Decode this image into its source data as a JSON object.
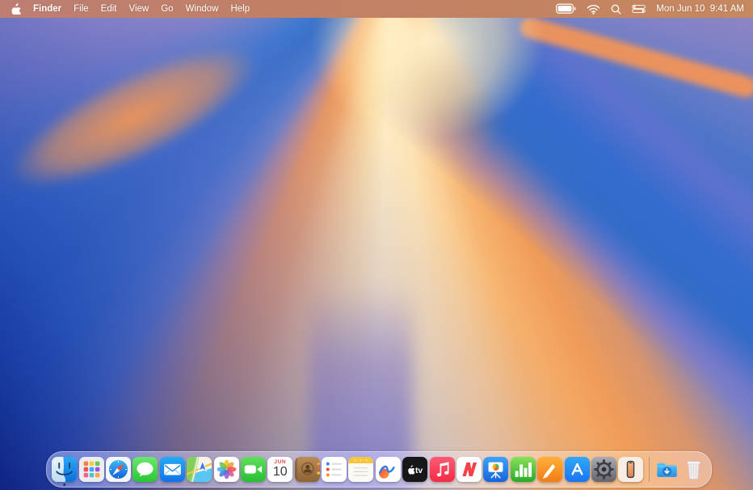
{
  "menu_bar": {
    "app_name": "Finder",
    "menus": [
      "File",
      "Edit",
      "View",
      "Go",
      "Window",
      "Help"
    ],
    "status_icons": [
      "battery-icon",
      "wifi-icon",
      "search-icon",
      "control-center-icon"
    ],
    "clock": "Mon Jun 10  9:41 AM"
  },
  "dock": {
    "apps": [
      {
        "name": "Finder",
        "icon": "finder-icon",
        "running": true
      },
      {
        "name": "Launchpad",
        "icon": "launchpad-icon"
      },
      {
        "name": "Safari",
        "icon": "safari-icon"
      },
      {
        "name": "Messages",
        "icon": "messages-icon"
      },
      {
        "name": "Mail",
        "icon": "mail-icon"
      },
      {
        "name": "Maps",
        "icon": "maps-icon"
      },
      {
        "name": "Photos",
        "icon": "photos-icon"
      },
      {
        "name": "FaceTime",
        "icon": "facetime-icon"
      },
      {
        "name": "Calendar",
        "icon": "calendar-icon",
        "month": "JUN",
        "day": "10"
      },
      {
        "name": "Contacts",
        "icon": "contacts-icon"
      },
      {
        "name": "Reminders",
        "icon": "reminders-icon"
      },
      {
        "name": "Notes",
        "icon": "notes-icon"
      },
      {
        "name": "Freeform",
        "icon": "freeform-icon"
      },
      {
        "name": "Apple TV",
        "icon": "apple-tv-icon",
        "label": "tv"
      },
      {
        "name": "Music",
        "icon": "music-icon"
      },
      {
        "name": "News",
        "icon": "news-icon"
      },
      {
        "name": "Keynote",
        "icon": "keynote-icon"
      },
      {
        "name": "Numbers",
        "icon": "numbers-icon"
      },
      {
        "name": "Pages",
        "icon": "pages-icon"
      },
      {
        "name": "App Store",
        "icon": "app-store-icon"
      },
      {
        "name": "System Settings",
        "icon": "system-settings-icon"
      },
      {
        "name": "iPhone Mirroring",
        "icon": "iphone-mirroring-icon"
      },
      {
        "name": "Downloads",
        "icon": "downloads-folder-icon"
      },
      {
        "name": "Trash",
        "icon": "trash-icon"
      }
    ]
  },
  "wallpaper": {
    "name": "macOS Sequoia sunburst",
    "palette": {
      "deep_blue": "#16379E",
      "blue": "#2E6AC8",
      "cream": "#FCE9C0",
      "orange": "#F09455",
      "lavender": "#9C94CC",
      "menubar_tint": "#C18066"
    }
  }
}
